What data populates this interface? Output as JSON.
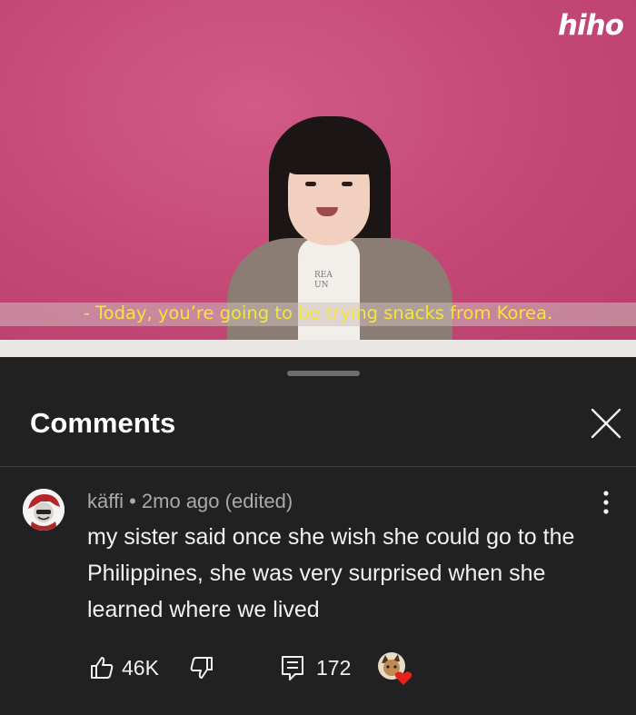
{
  "video": {
    "channel_logo": "hiho",
    "subtitle": "- Today, you’re going to be trying snacks from Korea.",
    "shirt_text": "REA\nUN",
    "background_color": "#c74c78",
    "subtitle_color": "#f5e43a"
  },
  "comments_panel": {
    "title": "Comments",
    "close_icon": "close-icon"
  },
  "comment": {
    "author": "käffi",
    "separator": "•",
    "time": "2mo ago (edited)",
    "text": "my sister said once she wish she could go to the Philippines, she was very surprised when she learned where we lived",
    "likes": "46K",
    "replies": "172",
    "icons": [
      "thumbs-up-icon",
      "thumbs-down-icon",
      "reply-icon",
      "more-vert-icon",
      "creator-heart-icon"
    ],
    "heart_color": "#e0241b"
  }
}
